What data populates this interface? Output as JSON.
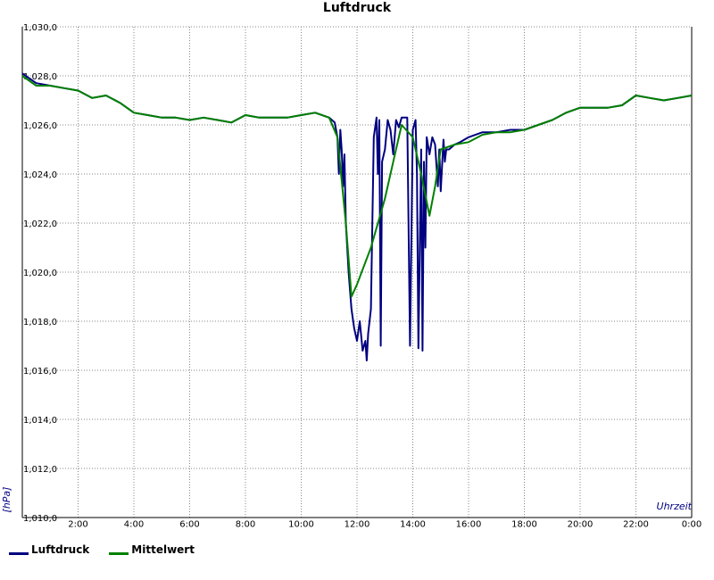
{
  "chart_data": {
    "type": "line",
    "title": "Luftdruck",
    "ylabel": "[hPa]",
    "xlabel": "Uhrzeit",
    "ylim": [
      1010,
      1030
    ],
    "xlim": [
      0,
      24
    ],
    "grid": true,
    "legend_position": "bottom-left",
    "y_ticks": [
      "1,010,0",
      "1,012,0",
      "1,014,0",
      "1,016,0",
      "1,018,0",
      "1,020,0",
      "1,022,0",
      "1,024,0",
      "1,026,0",
      "1,028,0",
      "1,030,0"
    ],
    "x_ticks": [
      "2:00",
      "4:00",
      "6:00",
      "8:00",
      "10:00",
      "12:00",
      "14:00",
      "16:00",
      "18:00",
      "20:00",
      "22:00",
      "0:00"
    ],
    "colors": {
      "Luftdruck": "#000080",
      "Mittelwert": "#008000"
    },
    "series": [
      {
        "name": "Luftdruck",
        "x": [
          0.0,
          0.5,
          1.0,
          1.5,
          2.0,
          2.5,
          3.0,
          3.5,
          4.0,
          4.5,
          5.0,
          5.5,
          6.0,
          6.5,
          7.0,
          7.5,
          8.0,
          8.5,
          9.0,
          9.5,
          10.0,
          10.5,
          11.0,
          11.2,
          11.3,
          11.35,
          11.4,
          11.45,
          11.5,
          11.55,
          11.6,
          11.7,
          11.8,
          11.9,
          12.0,
          12.1,
          12.2,
          12.3,
          12.35,
          12.4,
          12.5,
          12.6,
          12.7,
          12.75,
          12.8,
          12.85,
          12.9,
          13.0,
          13.1,
          13.2,
          13.3,
          13.4,
          13.5,
          13.6,
          13.8,
          13.9,
          14.0,
          14.1,
          14.15,
          14.2,
          14.3,
          14.35,
          14.4,
          14.45,
          14.5,
          14.6,
          14.7,
          14.8,
          14.9,
          14.95,
          15.0,
          15.1,
          15.15,
          15.2,
          15.3,
          15.5,
          15.7,
          16.0,
          16.5,
          17.0,
          17.5,
          18.0,
          18.5,
          19.0,
          19.5,
          20.0,
          20.5,
          21.0,
          21.5,
          22.0,
          22.5,
          23.0,
          23.5,
          24.0
        ],
        "values": [
          1028.1,
          1027.7,
          1027.6,
          1027.5,
          1027.4,
          1027.1,
          1027.2,
          1026.9,
          1026.5,
          1026.4,
          1026.3,
          1026.3,
          1026.2,
          1026.3,
          1026.2,
          1026.1,
          1026.4,
          1026.3,
          1026.3,
          1026.3,
          1026.4,
          1026.5,
          1026.3,
          1026.1,
          1025.5,
          1024.0,
          1025.8,
          1025.0,
          1023.5,
          1024.8,
          1022.0,
          1020.0,
          1018.5,
          1017.7,
          1017.2,
          1018.0,
          1016.8,
          1017.2,
          1016.4,
          1017.5,
          1018.5,
          1025.5,
          1026.3,
          1024.0,
          1026.2,
          1017.0,
          1024.5,
          1025.0,
          1026.2,
          1025.8,
          1024.8,
          1026.2,
          1025.9,
          1026.3,
          1026.3,
          1017.0,
          1025.8,
          1026.2,
          1024.0,
          1016.9,
          1025.0,
          1016.8,
          1024.5,
          1021.0,
          1025.5,
          1024.8,
          1025.5,
          1025.2,
          1023.5,
          1025.0,
          1023.3,
          1025.4,
          1024.5,
          1025.0,
          1025.0,
          1025.2,
          1025.3,
          1025.5,
          1025.7,
          1025.7,
          1025.8,
          1025.8,
          1026.0,
          1026.2,
          1026.5,
          1026.7,
          1026.7,
          1026.7,
          1026.8,
          1027.2,
          1027.1,
          1027.0,
          1027.1,
          1027.2
        ]
      },
      {
        "name": "Mittelwert",
        "x": [
          0.0,
          0.5,
          1.0,
          1.5,
          2.0,
          2.5,
          3.0,
          3.5,
          4.0,
          4.5,
          5.0,
          5.5,
          6.0,
          6.5,
          7.0,
          7.5,
          8.0,
          8.5,
          9.0,
          9.5,
          10.0,
          10.5,
          11.0,
          11.3,
          11.6,
          11.8,
          12.0,
          12.5,
          13.0,
          13.3,
          13.6,
          14.0,
          14.3,
          14.6,
          14.8,
          15.0,
          15.5,
          16.0,
          16.5,
          17.0,
          17.5,
          18.0,
          18.5,
          19.0,
          19.5,
          20.0,
          20.5,
          21.0,
          21.5,
          22.0,
          22.5,
          23.0,
          23.5,
          24.0
        ],
        "values": [
          1028.0,
          1027.6,
          1027.6,
          1027.5,
          1027.4,
          1027.1,
          1027.2,
          1026.9,
          1026.5,
          1026.4,
          1026.3,
          1026.3,
          1026.2,
          1026.3,
          1026.2,
          1026.1,
          1026.4,
          1026.3,
          1026.3,
          1026.3,
          1026.4,
          1026.5,
          1026.3,
          1025.5,
          1022.0,
          1019.0,
          1019.5,
          1021.0,
          1023.0,
          1024.5,
          1026.0,
          1025.5,
          1024.0,
          1022.3,
          1023.5,
          1025.0,
          1025.2,
          1025.3,
          1025.6,
          1025.7,
          1025.7,
          1025.8,
          1026.0,
          1026.2,
          1026.5,
          1026.7,
          1026.7,
          1026.7,
          1026.8,
          1027.2,
          1027.1,
          1027.0,
          1027.1,
          1027.2
        ]
      }
    ]
  }
}
